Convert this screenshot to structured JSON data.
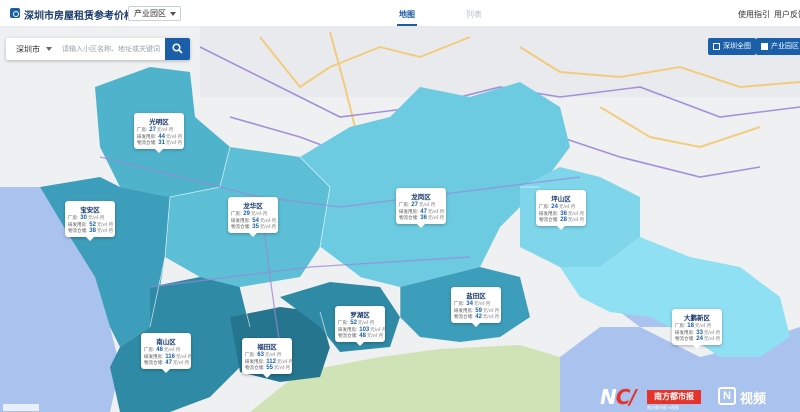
{
  "header": {
    "title": "深圳市房屋租赁参考价格查询平台",
    "district_select": "产业园区",
    "tabs": [
      {
        "label": "地图",
        "active": true
      },
      {
        "label": "列表",
        "active": false
      }
    ],
    "links": [
      "使用指引",
      "用户反馈"
    ]
  },
  "search": {
    "city": "深圳市",
    "placeholder": "请输入小区名称、地址或关键词"
  },
  "map_buttons": {
    "fullscreen": "深圳全图",
    "industry": "产业园区"
  },
  "card_labels": {
    "factory": "厂房:",
    "rd": "研发用房:",
    "warehouse": "物流仓储:",
    "unit": "元/㎡·月"
  },
  "districts": [
    {
      "name": "光明区",
      "factory": "27",
      "rd": "44",
      "warehouse": "31"
    },
    {
      "name": "宝安区",
      "factory": "30",
      "rd": "52",
      "warehouse": "38"
    },
    {
      "name": "龙华区",
      "factory": "29",
      "rd": "54",
      "warehouse": "35"
    },
    {
      "name": "龙岗区",
      "factory": "27",
      "rd": "47",
      "warehouse": "36"
    },
    {
      "name": "坪山区",
      "factory": "24",
      "rd": "36",
      "warehouse": "28"
    },
    {
      "name": "盐田区",
      "factory": "34",
      "rd": "59",
      "warehouse": "42"
    },
    {
      "name": "罗湖区",
      "factory": "52",
      "rd": "103",
      "warehouse": "48"
    },
    {
      "name": "福田区",
      "factory": "63",
      "rd": "112",
      "warehouse": "55"
    },
    {
      "name": "南山区",
      "factory": "46",
      "rd": "116",
      "warehouse": "47"
    },
    {
      "name": "大鹏新区",
      "factory": "18",
      "rd": "33",
      "warehouse": "24"
    }
  ],
  "watermark": {
    "nc": "N",
    "nc_slash": "C/",
    "brand": "南方都市报",
    "brand_sub": "南方都市报 N视频",
    "n_mark": "N",
    "video": "视频"
  },
  "colors": {
    "brand_blue": "#1a5fa8",
    "sea": "#9fb8ea",
    "district_light": "#7fd6ea",
    "district_mid": "#4fb3cc",
    "district_dark": "#2f8aa6",
    "district_darkest": "#25758e",
    "watermark_red": "#e3332b"
  }
}
